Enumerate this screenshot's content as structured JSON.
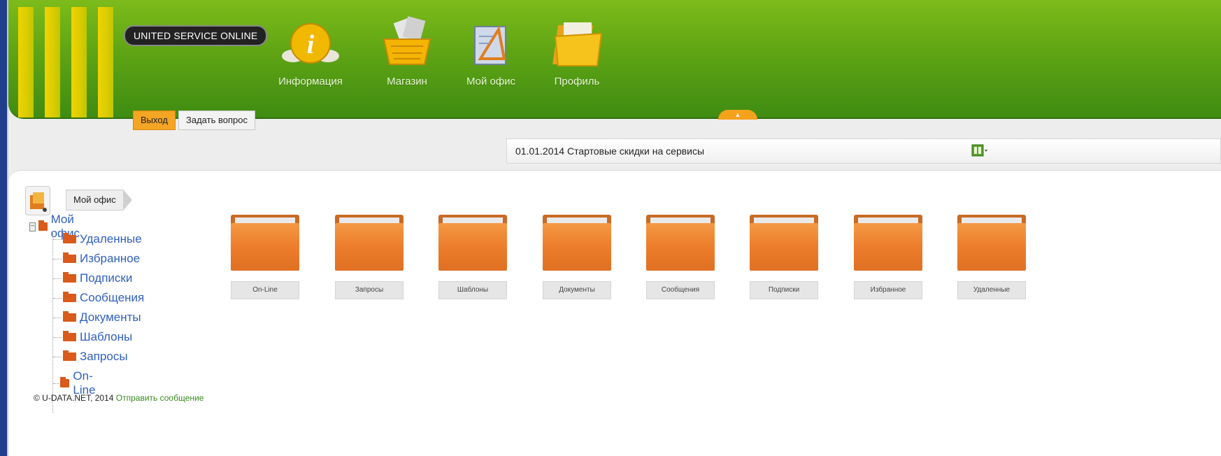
{
  "header": {
    "brand": "UNITED SERVICE ONLINE",
    "nav": [
      {
        "label": "Информация",
        "icon": "info-icon"
      },
      {
        "label": "Магазин",
        "icon": "shop-basket-icon"
      },
      {
        "label": "Мой офис",
        "icon": "office-icon"
      },
      {
        "label": "Профиль",
        "icon": "profile-folder-icon"
      }
    ],
    "exit_label": "Выход",
    "ask_label": "Задать вопрос"
  },
  "news": {
    "text": "01.01.2014 Стартовые скидки на сервисы",
    "icon": "layout-icon"
  },
  "breadcrumb": {
    "label": "Мой офис"
  },
  "tree": {
    "root": "Мой офис",
    "items": [
      "Удаленные",
      "Избранное",
      "Подписки",
      "Сообщения",
      "Документы",
      "Шаблоны",
      "Запросы",
      "On-Line"
    ]
  },
  "folders": [
    "On-Line",
    "Запросы",
    "Шаблоны",
    "Документы",
    "Сообщения",
    "Подписки",
    "Избранное",
    "Удаленные"
  ],
  "footer": {
    "copyright": "© U-DATA.NET, 2014",
    "link": "Отправить сообщение"
  },
  "colors": {
    "header_green": "#5fa414",
    "stripe_yellow": "#f2d300",
    "folder_orange": "#ec7d2c",
    "link_blue": "#2f5fbf",
    "link_green": "#3a8a1e"
  }
}
